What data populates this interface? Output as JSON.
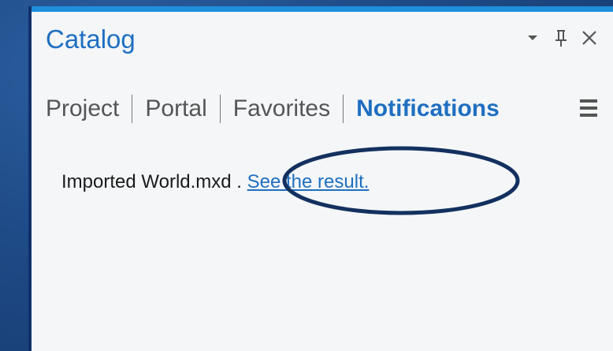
{
  "panel": {
    "title": "Catalog",
    "controls": {
      "dropdown_icon": "chevron-down-icon",
      "pin_icon": "pin-icon",
      "close_icon": "close-icon"
    },
    "tabs": [
      {
        "label": "Project",
        "active": false
      },
      {
        "label": "Portal",
        "active": false
      },
      {
        "label": "Favorites",
        "active": false
      },
      {
        "label": "Notifications",
        "active": true
      }
    ],
    "menu_icon": "hamburger-menu-icon"
  },
  "notification": {
    "text_prefix": "Imported  World.mxd",
    "text_dot": " . ",
    "link_text": "See the result."
  },
  "colors": {
    "accent": "#1f6fc1",
    "topbar": "#1f8fdb",
    "highlight_ring": "#13305f"
  }
}
